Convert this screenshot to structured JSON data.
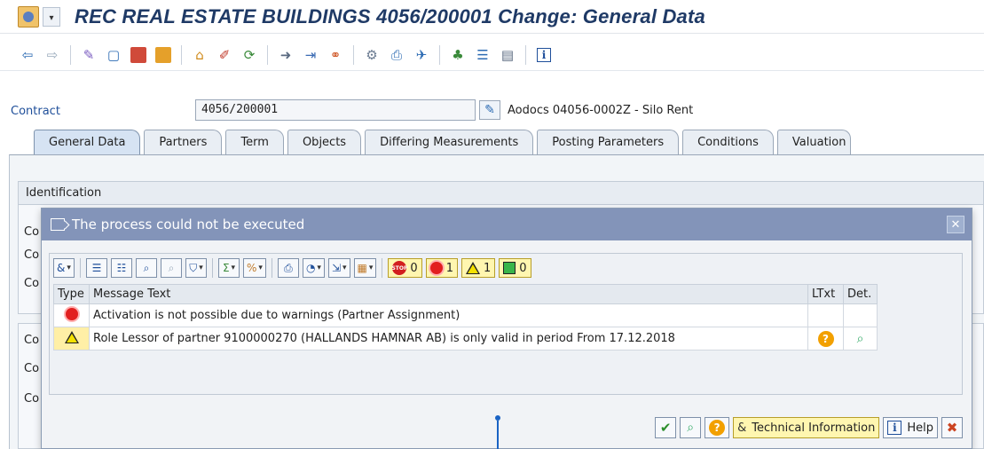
{
  "window": {
    "title": "REC REAL ESTATE BUILDINGS 4056/200001 Change: General Data"
  },
  "toolbar": {
    "icons": [
      "back-icon",
      "forward-icon",
      "display-change-icon",
      "create-icon",
      "copy-icon",
      "move-icon",
      "create-sub-icon",
      "edit-icon",
      "refresh-icon",
      "goto-icon",
      "navigate-icon",
      "link-icon",
      "settings-icon",
      "print-icon",
      "attach-icon",
      "hierarchy-icon",
      "list-icon",
      "table-icon",
      "info-icon"
    ]
  },
  "contract": {
    "label": "Contract",
    "value": "4056/200001",
    "description": "Aodocs 04056-0002Z - Silo Rent"
  },
  "tabs": [
    {
      "label": "General Data",
      "active": true
    },
    {
      "label": "Partners"
    },
    {
      "label": "Term"
    },
    {
      "label": "Objects"
    },
    {
      "label": "Differing Measurements"
    },
    {
      "label": "Posting Parameters"
    },
    {
      "label": "Conditions"
    },
    {
      "label": "Valuation"
    }
  ],
  "groups": {
    "identification": "Identification",
    "stub": "Co"
  },
  "dialog": {
    "title": "The process could not be executed",
    "counters": {
      "stop": "0",
      "error": "1",
      "warning": "1",
      "success": "0"
    },
    "stop_text": "STOP",
    "columns": {
      "type": "Type",
      "message": "Message Text",
      "ltxt": "LTxt",
      "det": "Det."
    },
    "messages": [
      {
        "type": "error",
        "text": "Activation is not possible due to warnings (Partner Assignment)"
      },
      {
        "type": "warning",
        "text": "Role Lessor of partner 9100000270 (HALLANDS HAMNAR AB) is only valid in period From 17.12.2018"
      }
    ],
    "footer": {
      "technical_info": "Technical Information",
      "help": "Help"
    }
  },
  "colors": {
    "dialog_header": "#8394b9",
    "title": "#1f3a66",
    "highlight_yellow": "#fff6b0"
  }
}
